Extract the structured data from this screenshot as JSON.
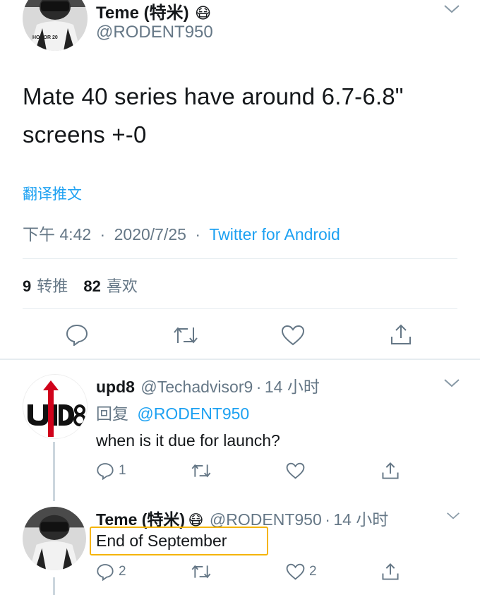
{
  "colors": {
    "accent": "#1da1f2",
    "muted": "#657786",
    "text": "#14171a",
    "highlight": "#f5b400",
    "divider": "#e6ecf0"
  },
  "main_tweet": {
    "author_name": "Teme (特米)",
    "author_emoji": "😷",
    "author_handle": "@RODENT950",
    "avatar_overlay_text": "HONOR 20",
    "text_line1": "Mate 40 series have around 6.7-6.8\"",
    "text_line2": "screens +-0",
    "translate_label": "翻译推文",
    "time": "下午 4:42",
    "date": "2020/7/25",
    "source": "Twitter for Android",
    "retweet_count": "9",
    "retweet_label": "转推",
    "like_count": "82",
    "like_label": "喜欢",
    "icons": [
      "reply-icon",
      "retweet-icon",
      "like-icon",
      "share-icon"
    ]
  },
  "replies": [
    {
      "author_name": "upd8",
      "author_handle": "@Techadvisor9",
      "time_ago": "14 小时",
      "reply_prefix": "回复",
      "reply_to": "@RODENT950",
      "text": "when is it due for launch?",
      "reply_count": "1",
      "retweet_count": "",
      "like_count": ""
    },
    {
      "author_name": "Teme (特米)",
      "author_emoji": "😷",
      "author_handle": "@RODENT950",
      "time_ago": "14 小时",
      "text": "End of September",
      "reply_count": "2",
      "retweet_count": "",
      "like_count": "2"
    }
  ],
  "separator": "·"
}
